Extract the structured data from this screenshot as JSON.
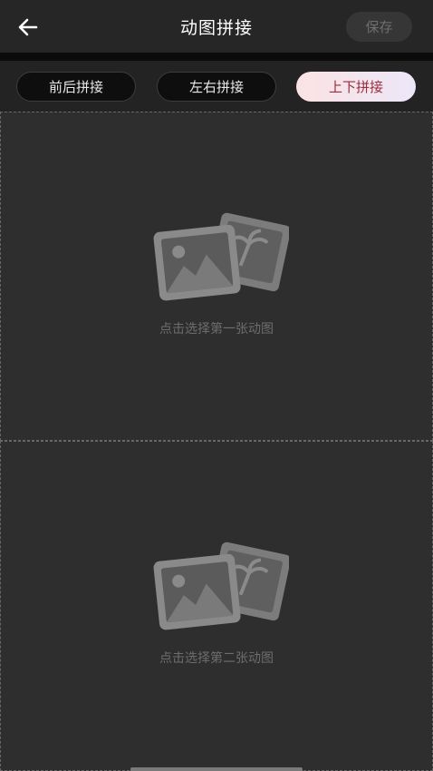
{
  "header": {
    "back_icon": "arrow-left-icon",
    "title": "动图拼接",
    "save_label": "保存"
  },
  "tabs": [
    {
      "label": "前后拼接",
      "selected": false
    },
    {
      "label": "左右拼接",
      "selected": false
    },
    {
      "label": "上下拼接",
      "selected": true
    }
  ],
  "slots": [
    {
      "icon": "image-placeholder-icon",
      "label": "点击选择第一张动图"
    },
    {
      "icon": "image-placeholder-icon",
      "label": "点击选择第二张动图"
    }
  ],
  "colors": {
    "background": "#2e2e2e",
    "selected_tab_text": "#9a2e3a",
    "selected_tab_bg_start": "#fbe3e3",
    "selected_tab_bg_end": "#ece7f8"
  }
}
